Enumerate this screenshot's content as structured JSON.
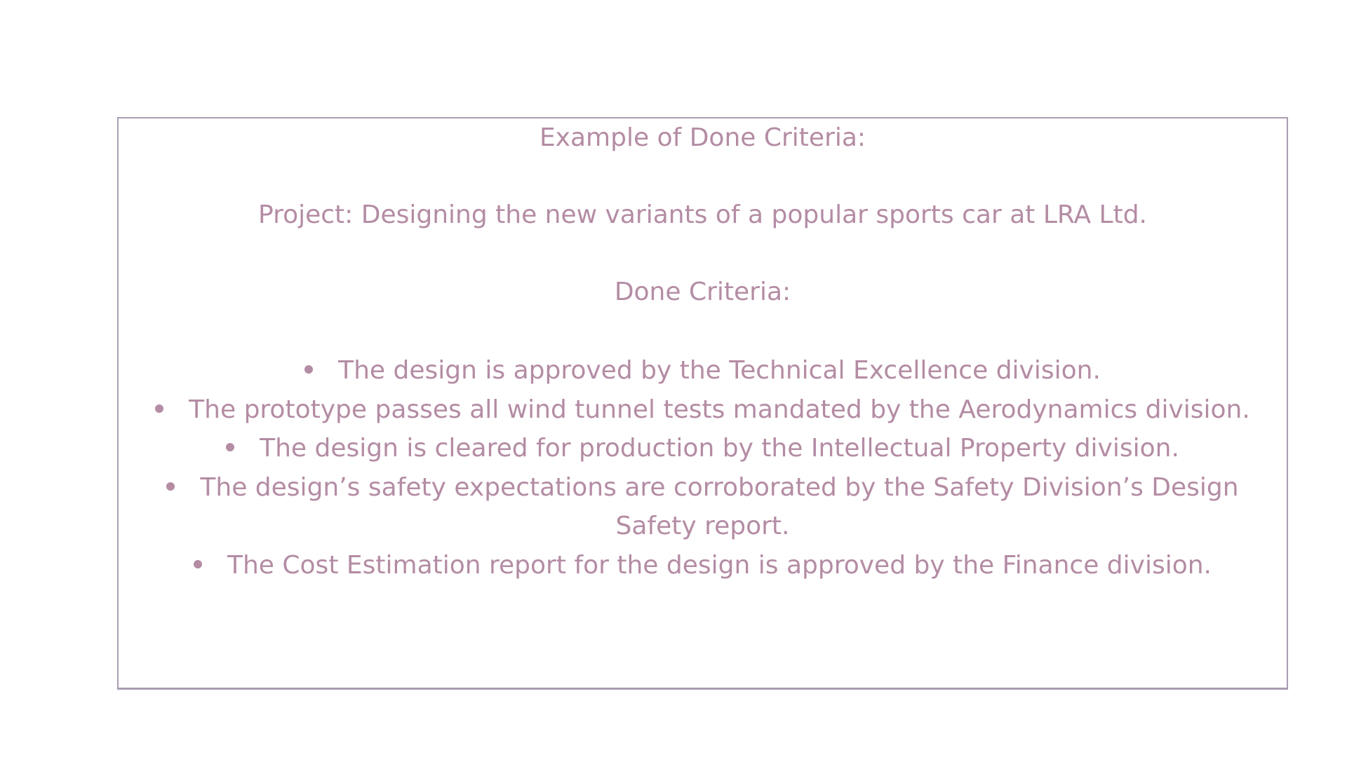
{
  "slide": {
    "title": "Example of Done Criteria:",
    "project": "Project: Designing the new variants of a popular sports car at LRA Ltd.",
    "done_heading": "Done Criteria:",
    "criteria": [
      {
        "line1": "The design is approved by the Technical Excellence division."
      },
      {
        "line1": "The prototype passes all wind tunnel tests mandated by the Aerodynamics division."
      },
      {
        "line1": "The design is cleared for production by the Intellectual Property division."
      },
      {
        "line1": "The design’s safety expectations are corroborated by the Safety Division’s Design",
        "line2": "Safety report."
      },
      {
        "line1": "The Cost Estimation report for the design is approved by the Finance division."
      }
    ]
  },
  "colors": {
    "text": "#b48ca4",
    "border": "#a89db2",
    "background": "#ffffff"
  },
  "icons": [
    "bullet-dot-icon"
  ]
}
